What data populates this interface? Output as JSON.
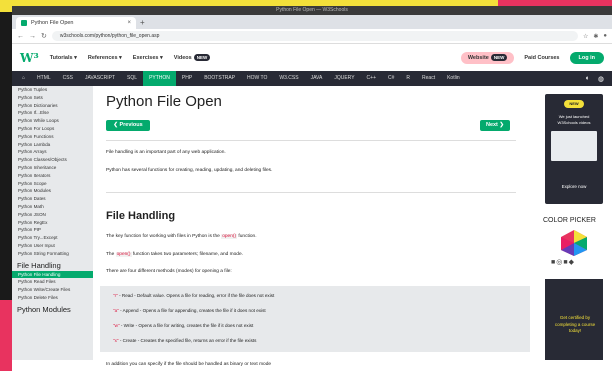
{
  "window": {
    "title": "Python File Open — W3Schools"
  },
  "browser": {
    "tab_title": "Python File Open",
    "tab_close": "×",
    "new_tab": "+",
    "url": "w3schools.com/python/python_file_open.asp"
  },
  "header": {
    "logo": "W³",
    "menus": [
      "Tutorials ▾",
      "References ▾",
      "Exercises ▾"
    ],
    "videos_label": "Videos",
    "videos_badge": "NEW",
    "website_label": "Website",
    "website_badge": "NEW",
    "paid_courses": "Paid Courses",
    "login": "Log in"
  },
  "topnav": {
    "items": [
      "HTML",
      "CSS",
      "JAVASCRIPT",
      "SQL",
      "PYTHON",
      "PHP",
      "BOOTSTRAP",
      "HOW TO",
      "W3.CSS",
      "JAVA",
      "JQUERY",
      "C++",
      "C#",
      "R",
      "React",
      "Kotlin"
    ],
    "active_index": 4
  },
  "sidebar": {
    "items": [
      "Python Tuples",
      "Python Sets",
      "Python Dictionaries",
      "Python If...Else",
      "Python While Loops",
      "Python For Loops",
      "Python Functions",
      "Python Lambda",
      "Python Arrays",
      "Python Classes/Objects",
      "Python Inheritance",
      "Python Iterators",
      "Python Scope",
      "Python Modules",
      "Python Dates",
      "Python Math",
      "Python JSON",
      "Python RegEx",
      "Python PIP",
      "Python Try...Except",
      "Python User Input",
      "Python String Formatting"
    ],
    "section_file": "File Handling",
    "file_items": [
      "Python File Handling",
      "Python Read Files",
      "Python Write/Create Files",
      "Python Delete Files"
    ],
    "active_file_index": 0,
    "section_modules": "Python Modules"
  },
  "main": {
    "title": "Python File Open",
    "prev": "❮ Previous",
    "next": "Next ❯",
    "intro1": "File handling is an important part of any web application.",
    "intro2": "Python has several functions for creating, reading, updating, and deleting files.",
    "h2": "File Handling",
    "key_pre": "The key function for working with files in Python is the",
    "key_code": "open()",
    "key_post": "function.",
    "params_pre": "The",
    "params_code": "open()",
    "params_post": "function takes two parameters; filename, and mode.",
    "modes_intro": "There are four different methods (modes) for opening a file:",
    "modes": [
      {
        "mode": "\"r\"",
        "desc": "- Read - Default value. Opens a file for reading, error if the file does not exist"
      },
      {
        "mode": "\"a\"",
        "desc": "- Append - Opens a file for appending, creates the file if it does not exist"
      },
      {
        "mode": "\"w\"",
        "desc": "- Write - Opens a file for writing, creates the file if it does not exist"
      },
      {
        "mode": "\"x\"",
        "desc": "- Create - Creates the specified file, returns an error if the file exists"
      }
    ],
    "additional": "In addition you can specify if the file should be handled as binary or text mode"
  },
  "right": {
    "ad_badge": "NEW",
    "ad_text": "We just launched W3Schools videos",
    "ad_explore": "Explore now",
    "color_picker": "COLOR PICKER",
    "ad2_text": "Get certified by completing a course today!"
  },
  "colors": {
    "accent": "#04aa6d",
    "nav": "#282a35",
    "yellow": "#f3e03a",
    "pink": "#e8335f"
  }
}
